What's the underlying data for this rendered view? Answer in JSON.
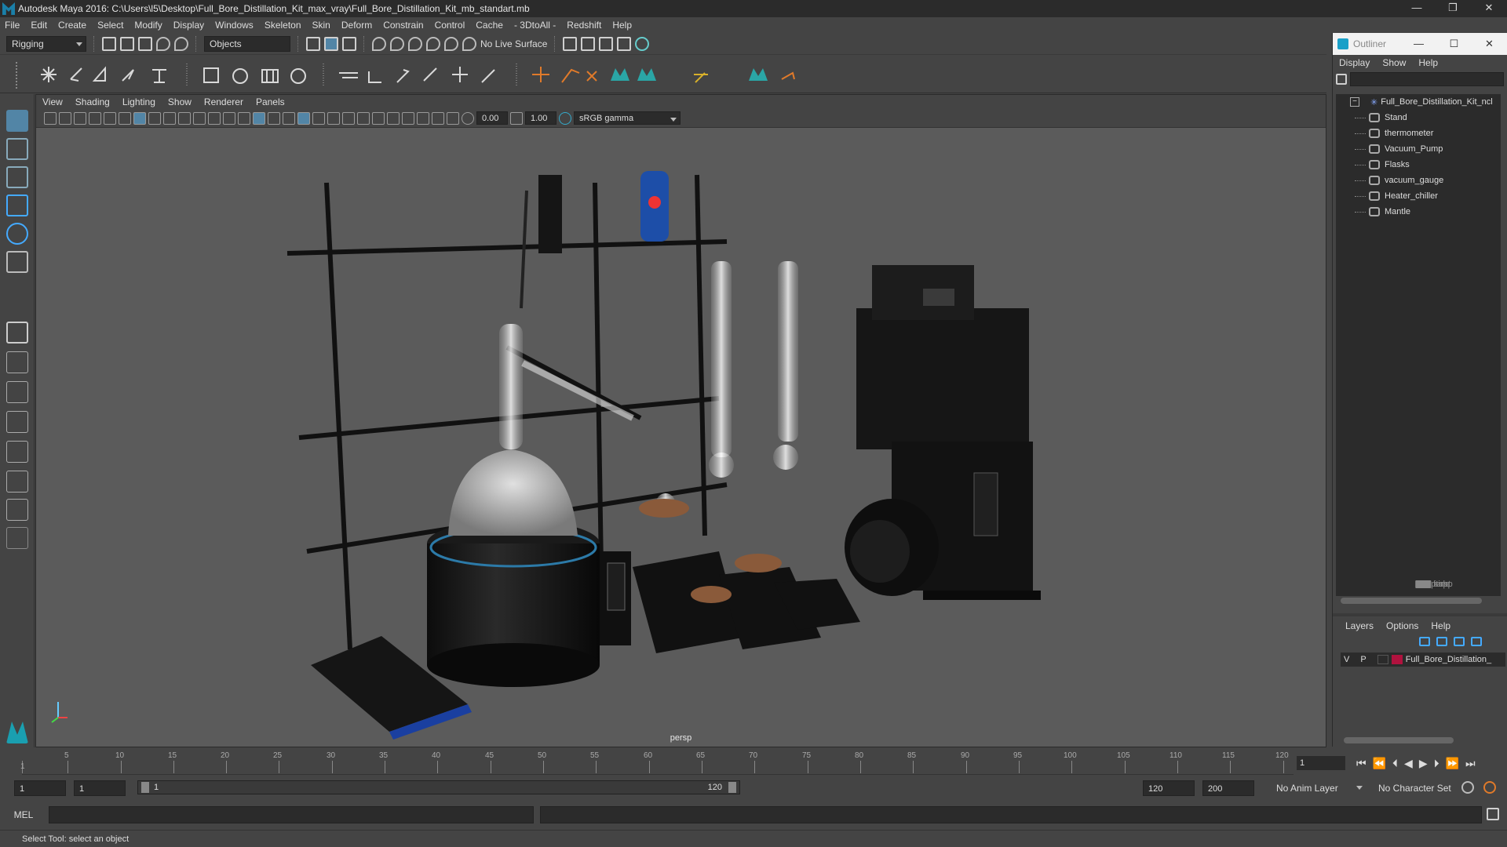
{
  "window": {
    "title": "Autodesk Maya 2016: C:\\Users\\l5\\Desktop\\Full_Bore_Distillation_Kit_max_vray\\Full_Bore_Distillation_Kit_mb_standart.mb",
    "min": "—",
    "restore": "❐",
    "close": "✕"
  },
  "menubar": {
    "items": [
      "File",
      "Edit",
      "Create",
      "Select",
      "Modify",
      "Display",
      "Windows",
      "Skeleton",
      "Skin",
      "Deform",
      "Constrain",
      "Control",
      "Cache",
      "- 3DtoAll -",
      "Redshift",
      "Help"
    ]
  },
  "status": {
    "mode": "Rigging",
    "selmode": "Objects",
    "live": "No Live Surface"
  },
  "viewport": {
    "menu": [
      "View",
      "Shading",
      "Lighting",
      "Show",
      "Renderer",
      "Panels"
    ],
    "gamma_val": "0.00",
    "exposure_val": "1.00",
    "colorspace": "sRGB gamma",
    "camera": "persp"
  },
  "outliner": {
    "title": "Outliner",
    "menu": [
      "Display",
      "Show",
      "Help"
    ],
    "cameras": [
      "persp",
      "top",
      "front",
      "side"
    ],
    "root": "Full_Bore_Distillation_Kit_ncl",
    "children": [
      "Stand",
      "thermometer",
      "Vacuum_Pump",
      "Flasks",
      "vacuum_gauge",
      "Heater_chiller",
      "Mantle"
    ]
  },
  "layers": {
    "menu": [
      "Layers",
      "Options",
      "Help"
    ],
    "v": "V",
    "p": "P",
    "name": "Full_Bore_Distillation_",
    "color": "#b0123e"
  },
  "timeline": {
    "ticks": [
      "5",
      "10",
      "15",
      "20",
      "25",
      "30",
      "35",
      "40",
      "45",
      "50",
      "55",
      "60",
      "65",
      "70",
      "75",
      "80",
      "85",
      "90",
      "95",
      "100",
      "105",
      "110",
      "115",
      "120"
    ],
    "start_tick": "1",
    "current": "1"
  },
  "range": {
    "start": "1",
    "start2": "1",
    "slider_start": "1",
    "slider_end": "120",
    "end": "120",
    "end2": "200",
    "anim_layer": "No Anim Layer",
    "char_set": "No Character Set"
  },
  "cmd": {
    "label": "MEL"
  },
  "help": {
    "text": "Select Tool: select an object"
  }
}
